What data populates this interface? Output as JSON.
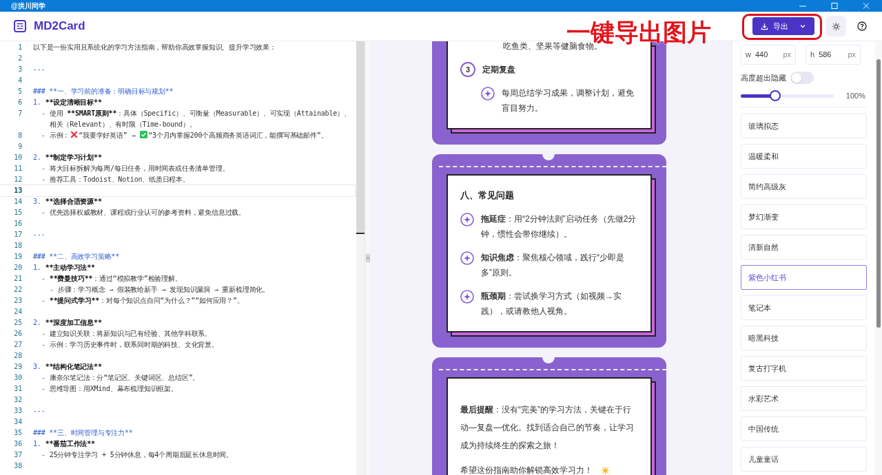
{
  "window": {
    "title": "@洪川同学"
  },
  "header": {
    "app_name": "MD2Card",
    "export_button": "导出"
  },
  "annotation": {
    "text": "一键导出图片"
  },
  "editor": {
    "lines": [
      {
        "n": "1",
        "kind": "plain",
        "current": false,
        "parts": [
          {
            "text": "以下是一份实用且系统化的学习方法指南，帮助你高效掌握知识、提升学习效果：",
            "bold": false
          }
        ]
      },
      {
        "n": "2",
        "kind": "empty",
        "current": false
      },
      {
        "n": "3",
        "kind": "rule",
        "current": false,
        "marker": "---"
      },
      {
        "n": "4",
        "kind": "empty",
        "current": false
      },
      {
        "n": "5",
        "kind": "heading",
        "current": false,
        "marker": "### **一、学习前的准备：明确目标与规划**"
      },
      {
        "n": "6",
        "kind": "item",
        "current": false,
        "marker": "1.",
        "parts": [
          {
            "text": "**设定清晰目标**",
            "bold": true
          }
        ]
      },
      {
        "n": "7",
        "kind": "bullet",
        "current": false,
        "marker": "-",
        "parts": [
          {
            "text": "使用 ",
            "bold": false
          },
          {
            "text": "**SMART原则**",
            "bold": true
          },
          {
            "text": "：具体（Specific）、可衡量（Measurable）、可实现（Attainable）、相关（Relevant）、有时限（Time-bound）。",
            "bold": false
          }
        ]
      },
      {
        "n": "8",
        "kind": "bullet",
        "current": false,
        "marker": "-",
        "parts": [
          {
            "text": "示例：",
            "bold": false
          },
          {
            "kind": "cross"
          },
          {
            "text": "“我要学好英语” → ",
            "bold": false
          },
          {
            "kind": "check"
          },
          {
            "text": "“3个月内掌握200个高频商务英语词汇，能撰写基础邮件”。",
            "bold": false
          }
        ]
      },
      {
        "n": "9",
        "kind": "empty",
        "current": false
      },
      {
        "n": "10",
        "kind": "item",
        "current": false,
        "marker": "2.",
        "parts": [
          {
            "text": "**制定学习计划**",
            "bold": true
          }
        ]
      },
      {
        "n": "11",
        "kind": "bullet",
        "current": false,
        "marker": "-",
        "parts": [
          {
            "text": "将大目标拆解为每周/每日任务，用时间表或任务清单管理。",
            "bold": false
          }
        ]
      },
      {
        "n": "12",
        "kind": "bullet",
        "current": false,
        "marker": "-",
        "parts": [
          {
            "text": "推荐工具：Todoist、Notion、纸质日程本。",
            "bold": false
          }
        ]
      },
      {
        "n": "13",
        "kind": "empty",
        "current": true
      },
      {
        "n": "14",
        "kind": "item",
        "current": false,
        "marker": "3.",
        "parts": [
          {
            "text": "**选择合适资源**",
            "bold": true
          }
        ]
      },
      {
        "n": "15",
        "kind": "bullet",
        "current": false,
        "marker": "-",
        "parts": [
          {
            "text": "优先选择权威教材、课程或行业认可的参考资料，避免信息过载。",
            "bold": false
          }
        ]
      },
      {
        "n": "16",
        "kind": "empty",
        "current": false
      },
      {
        "n": "17",
        "kind": "rule",
        "current": false,
        "marker": "---"
      },
      {
        "n": "18",
        "kind": "empty",
        "current": false
      },
      {
        "n": "19",
        "kind": "heading",
        "current": false,
        "marker": "### **二、高效学习策略**"
      },
      {
        "n": "20",
        "kind": "item",
        "current": false,
        "marker": "1.",
        "parts": [
          {
            "text": "**主动学习法**",
            "bold": true
          }
        ]
      },
      {
        "n": "21",
        "kind": "bullet",
        "current": false,
        "marker": "-",
        "parts": [
          {
            "text": "**费曼技巧**",
            "bold": true
          },
          {
            "text": "：通过“模拟教学”检验理解。",
            "bold": false
          }
        ]
      },
      {
        "n": "22",
        "kind": "subbullet",
        "current": false,
        "marker": "-",
        "parts": [
          {
            "text": "步骤：学习概念 → 假装教给新手 → 发现知识漏洞 → 重新梳理简化。",
            "bold": false
          }
        ]
      },
      {
        "n": "23",
        "kind": "bullet",
        "current": false,
        "marker": "-",
        "parts": [
          {
            "text": "**提问式学习**",
            "bold": true
          },
          {
            "text": "：对每个知识点自问“为什么？”“如何应用？”。",
            "bold": false
          }
        ]
      },
      {
        "n": "24",
        "kind": "empty",
        "current": false
      },
      {
        "n": "25",
        "kind": "item",
        "current": false,
        "marker": "2.",
        "parts": [
          {
            "text": "**深度加工信息**",
            "bold": true
          }
        ]
      },
      {
        "n": "26",
        "kind": "bullet",
        "current": false,
        "marker": "-",
        "parts": [
          {
            "text": "建立知识关联：将新知识与已有经验、其他学科联系。",
            "bold": false
          }
        ]
      },
      {
        "n": "27",
        "kind": "bullet",
        "current": false,
        "marker": "-",
        "parts": [
          {
            "text": "示例：学习历史事件时，联系同时期的科技、文化背景。",
            "bold": false
          }
        ]
      },
      {
        "n": "28",
        "kind": "empty",
        "current": false
      },
      {
        "n": "29",
        "kind": "item",
        "current": false,
        "marker": "3.",
        "parts": [
          {
            "text": "**结构化笔记法**",
            "bold": true
          }
        ]
      },
      {
        "n": "30",
        "kind": "bullet",
        "current": false,
        "marker": "-",
        "parts": [
          {
            "text": "康奈尔笔记法：分“笔记区、关键词区、总结区”。",
            "bold": false
          }
        ]
      },
      {
        "n": "31",
        "kind": "bullet",
        "current": false,
        "marker": "-",
        "parts": [
          {
            "text": "思维导图：用XMind、幕布梳理知识框架。",
            "bold": false
          }
        ]
      },
      {
        "n": "32",
        "kind": "empty",
        "current": false
      },
      {
        "n": "33",
        "kind": "rule",
        "current": false,
        "marker": "---"
      },
      {
        "n": "34",
        "kind": "empty",
        "current": false
      },
      {
        "n": "35",
        "kind": "heading",
        "current": false,
        "marker": "### **三、时间管理与专注力**"
      },
      {
        "n": "36",
        "kind": "item",
        "current": false,
        "marker": "1.",
        "parts": [
          {
            "text": "**番茄工作法**",
            "bold": true
          }
        ]
      },
      {
        "n": "37",
        "kind": "bullet",
        "current": false,
        "marker": "-",
        "parts": [
          {
            "text": "25分钟专注学习 + 5分钟休息，每4个周期后延长休息时间。",
            "bold": false
          }
        ]
      },
      {
        "n": "38",
        "kind": "empty",
        "current": false
      }
    ]
  },
  "preview": {
    "cards": [
      {
        "kind": "continued",
        "blocks": [
          {
            "kind": "continuation",
            "text": "吃鱼类、坚果等健脑食物。"
          },
          {
            "kind": "step",
            "number": "3",
            "text": "定期复盘"
          },
          {
            "kind": "point",
            "text": "每周总结学习成果，调整计划，避免盲目努力。"
          }
        ]
      },
      {
        "kind": "full",
        "title": "八、常见问题",
        "blocks": [
          {
            "kind": "point",
            "text": "**拖延症**：用“2分钟法则”启动任务（先做2分钟，惯性会带你继续）。"
          },
          {
            "kind": "point",
            "text": "**知识焦虑**：聚焦核心领域，践行“少即是多”原则。"
          },
          {
            "kind": "point",
            "text": "**瓶颈期**：尝试换学习方式（如视频→实践），或请教他人视角。"
          }
        ]
      },
      {
        "kind": "full",
        "blocks": [
          {
            "kind": "paragraph",
            "text": "**最后提醒**：没有“完美”的学习方法，关键在于行动—复盘—优化。找到适合自己的节奏，让学习成为持续终生的探索之旅！"
          },
          {
            "kind": "sign_off",
            "text": "希望这份指南助你解锁高效学习力！"
          }
        ]
      }
    ]
  },
  "settings": {
    "width": {
      "label": "w",
      "value": "440",
      "unit": "px"
    },
    "height": {
      "label": "h",
      "value": "586",
      "unit": "px"
    },
    "overflow_toggle": {
      "label": "高度超出隐藏",
      "on": false
    },
    "zoom": {
      "level": 0.37,
      "reading": "100%"
    },
    "themes": [
      {
        "name": "玻璃拟态",
        "selected": false
      },
      {
        "name": "温暖柔和",
        "selected": false
      },
      {
        "name": "简约高级灰",
        "selected": false
      },
      {
        "name": "梦幻渐变",
        "selected": false
      },
      {
        "name": "清新自然",
        "selected": false
      },
      {
        "name": "紫色小红书",
        "selected": true
      },
      {
        "name": "笔记本",
        "selected": false
      },
      {
        "name": "暗黑科技",
        "selected": false
      },
      {
        "name": "复古打字机",
        "selected": false
      },
      {
        "name": "水彩艺术",
        "selected": false
      },
      {
        "name": "中国传统",
        "selected": false
      },
      {
        "name": "儿童童话",
        "selected": false
      }
    ]
  }
}
